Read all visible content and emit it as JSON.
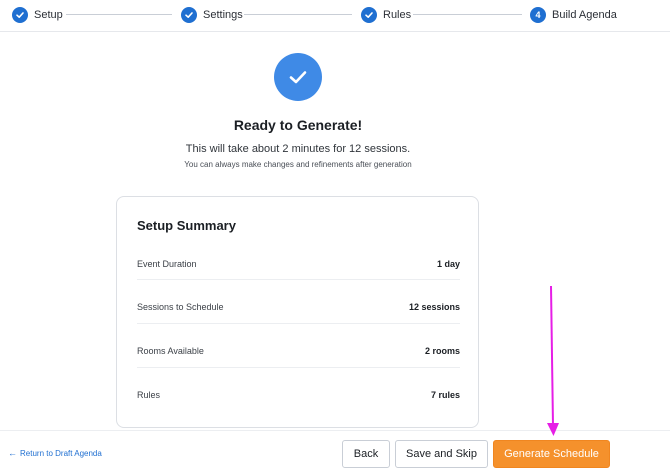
{
  "stepper": {
    "steps": [
      {
        "label": "Setup",
        "state": "done"
      },
      {
        "label": "Settings",
        "state": "done"
      },
      {
        "label": "Rules",
        "state": "done"
      },
      {
        "label": "Build Agenda",
        "state": "current",
        "number": "4"
      }
    ]
  },
  "hero": {
    "title": "Ready to Generate!",
    "subtitle": "This will take about 2 minutes for 12 sessions.",
    "hint": "You can always make changes and refinements after generation"
  },
  "summary": {
    "title": "Setup Summary",
    "rows": [
      {
        "label": "Event Duration",
        "value": "1 day"
      },
      {
        "label": "Sessions to Schedule",
        "value": "12 sessions"
      },
      {
        "label": "Rooms Available",
        "value": "2 rooms"
      },
      {
        "label": "Rules",
        "value": "7 rules"
      }
    ]
  },
  "footer": {
    "back_link": "Return to Draft Agenda",
    "back_button": "Back",
    "save_skip_button": "Save and Skip",
    "generate_button": "Generate Schedule"
  },
  "colors": {
    "accent_blue": "#1f6fd1",
    "hero_blue": "#3f8ae6",
    "primary_orange": "#f5912c",
    "annotation_magenta": "#e61ee6"
  }
}
